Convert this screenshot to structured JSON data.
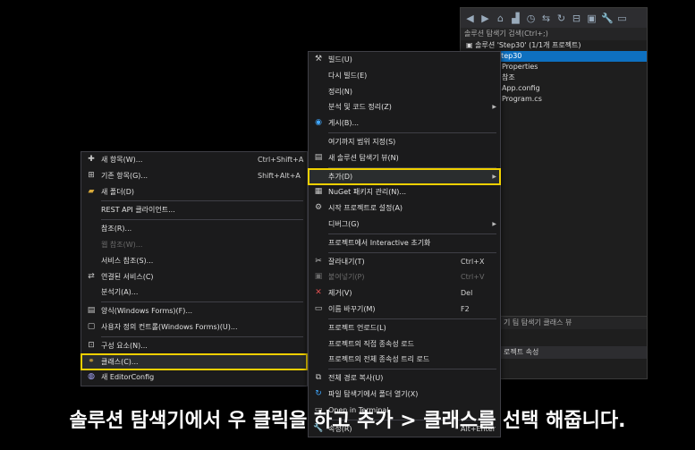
{
  "solution_explorer": {
    "toolbar_icons": [
      "back-icon",
      "forward-icon",
      "home-icon",
      "vs-icon",
      "history-icon",
      "sync-icon",
      "refresh-icon",
      "collapse-icon",
      "show-all-icon",
      "wrench-icon",
      "preview-icon"
    ],
    "search_placeholder": "솔루션 탐색기 검색(Ctrl+;)",
    "solution_label": "솔루션 'Step30' (1/1개 프로젝트)",
    "project_label": "Step30",
    "children": [
      "Properties",
      "참조",
      "App.config",
      "Program.cs"
    ],
    "tabs_label": "기  팀 탐색기  클래스 뷰",
    "properties_label": "로젝트 속성"
  },
  "context_menu": {
    "items": [
      {
        "label": "빌드(U)",
        "icon": "build-icon"
      },
      {
        "label": "다시 빌드(E)"
      },
      {
        "label": "정리(N)"
      },
      {
        "label": "분석 및 코드 정리(Z)",
        "submenu": true
      },
      {
        "label": "게시(B)...",
        "icon": "globe-icon"
      },
      {
        "sep": true
      },
      {
        "label": "여기까지 범위 지정(S)"
      },
      {
        "label": "새 솔루션 탐색기 뷰(N)",
        "icon": "new-view-icon"
      },
      {
        "sep": true
      },
      {
        "label": "추가(D)",
        "submenu": true,
        "highlight": true
      },
      {
        "label": "NuGet 패키지 관리(N)...",
        "icon": "nuget-icon"
      },
      {
        "label": "시작 프로젝트로 설정(A)",
        "icon": "gear-icon"
      },
      {
        "label": "디버그(G)",
        "submenu": true
      },
      {
        "sep": true
      },
      {
        "label": "프로젝트에서 Interactive 초기화"
      },
      {
        "sep": true
      },
      {
        "label": "잘라내기(T)",
        "shortcut": "Ctrl+X",
        "icon": "cut-icon"
      },
      {
        "label": "붙여넣기(P)",
        "shortcut": "Ctrl+V",
        "icon": "paste-icon",
        "disabled": true
      },
      {
        "label": "제거(V)",
        "shortcut": "Del",
        "icon": "delete-icon"
      },
      {
        "label": "이름 바꾸기(M)",
        "shortcut": "F2",
        "icon": "rename-icon"
      },
      {
        "sep": true
      },
      {
        "label": "프로젝트 언로드(L)"
      },
      {
        "label": "프로젝트의 직접 종속성 로드"
      },
      {
        "label": "프로젝트의 전체 종속성 트리 로드"
      },
      {
        "sep": true
      },
      {
        "label": "전체 경로 복사(U)",
        "icon": "copy-icon"
      },
      {
        "label": "파일 탐색기에서 폴더 열기(X)",
        "icon": "refresh-arrow-icon"
      },
      {
        "label": "Open in Terminal",
        "icon": "terminal-icon"
      },
      {
        "sep": true
      },
      {
        "label": "속성(R)",
        "shortcut": "Alt+Enter",
        "icon": "wrench-icon"
      }
    ]
  },
  "add_submenu": {
    "items": [
      {
        "label": "새 항목(W)...",
        "shortcut": "Ctrl+Shift+A",
        "icon": "new-item-icon"
      },
      {
        "label": "기존 항목(G)...",
        "shortcut": "Shift+Alt+A",
        "icon": "existing-item-icon"
      },
      {
        "label": "새 폴더(D)",
        "icon": "folder-icon"
      },
      {
        "sep": true
      },
      {
        "label": "REST API 클라이언트..."
      },
      {
        "sep": true
      },
      {
        "label": "참조(R)..."
      },
      {
        "label": "웹 참조(W)...",
        "disabled": true
      },
      {
        "label": "서비스 참조(S)..."
      },
      {
        "label": "연결된 서비스(C)",
        "icon": "connected-service-icon"
      },
      {
        "label": "분석기(A)..."
      },
      {
        "sep": true
      },
      {
        "label": "양식(Windows Forms)(F)...",
        "icon": "form-icon"
      },
      {
        "label": "사용자 정의 컨트롤(Windows Forms)(U)...",
        "icon": "user-control-icon"
      },
      {
        "sep": true
      },
      {
        "label": "구성 요소(N)...",
        "icon": "component-icon"
      },
      {
        "label": "클래스(C)...",
        "icon": "class-icon",
        "highlight": true
      },
      {
        "label": "새 EditorConfig",
        "icon": "editorconfig-icon"
      }
    ]
  },
  "caption": "솔루션 탐색기에서 우 클릭을 하고 추가 > 클래스를 선택 해줍니다.",
  "colors": {
    "highlight_box": "#f0d000",
    "selected_row": "#0e70c0",
    "menu_bg": "#1b1b1c"
  }
}
